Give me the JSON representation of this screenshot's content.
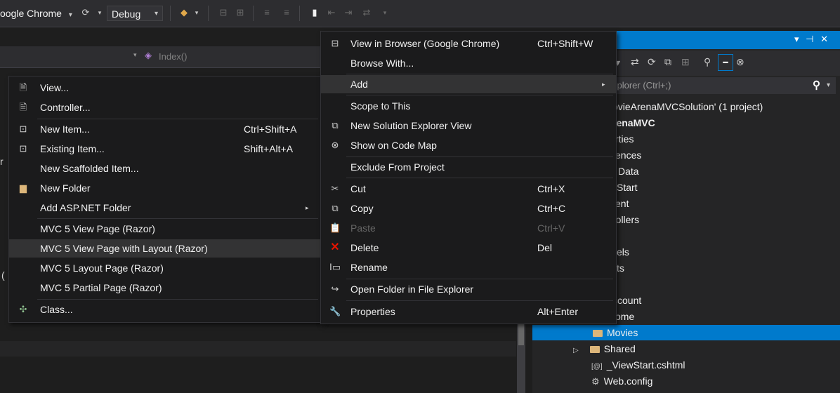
{
  "toolbar": {
    "browser_combo": "oogle Chrome",
    "browser_arrow": "▾",
    "config_combo": "Debug",
    "config_arrow": "▾"
  },
  "navbar": {
    "member": "Index()"
  },
  "solution_explorer": {
    "title_pin": "▾ ⊣ ✕",
    "search_placeholder": "xplorer (Ctrl+;)",
    "search_icon_text": "⚲",
    "tree": [
      "ovieArenaMVCSolution' (1 project)",
      "renaMVC",
      "rties",
      "ences",
      "Data",
      "Start",
      "ent",
      "rollers",
      "els",
      "ts",
      "",
      "ccount",
      "ome",
      "Movies",
      "Shared",
      "_ViewStart.cshtml",
      "Web.config"
    ],
    "shared_arrow": "▷"
  },
  "editor_fragments": {
    "frag1": "r",
    "frag2": "("
  },
  "context_menu": {
    "items": [
      {
        "label": "View in Browser (Google Chrome)",
        "shortcut": "Ctrl+Shift+W"
      },
      {
        "label": "Browse With..."
      },
      {
        "label": "Add",
        "arrow": "▸"
      },
      {
        "label": "Scope to This"
      },
      {
        "label": "New Solution Explorer View"
      },
      {
        "label": "Show on Code Map"
      },
      {
        "label": "Exclude From Project"
      },
      {
        "label": "Cut",
        "shortcut": "Ctrl+X"
      },
      {
        "label": "Copy",
        "shortcut": "Ctrl+C"
      },
      {
        "label": "Paste",
        "shortcut": "Ctrl+V"
      },
      {
        "label": "Delete",
        "shortcut": "Del"
      },
      {
        "label": "Rename"
      },
      {
        "label": "Open Folder in File Explorer"
      },
      {
        "label": "Properties",
        "shortcut": "Alt+Enter"
      }
    ]
  },
  "add_submenu": {
    "items": [
      {
        "label": "View..."
      },
      {
        "label": "Controller..."
      },
      {
        "label": "New Item...",
        "shortcut": "Ctrl+Shift+A"
      },
      {
        "label": "Existing Item...",
        "shortcut": "Shift+Alt+A"
      },
      {
        "label": "New Scaffolded Item..."
      },
      {
        "label": "New Folder"
      },
      {
        "label": "Add ASP.NET Folder",
        "arrow": "▸"
      },
      {
        "label": "MVC 5 View Page (Razor)"
      },
      {
        "label": "MVC 5 View Page with Layout (Razor)"
      },
      {
        "label": "MVC 5 Layout Page (Razor)"
      },
      {
        "label": "MVC 5 Partial Page (Razor)"
      },
      {
        "label": "Class..."
      }
    ]
  },
  "colors": {
    "accent": "#007acc",
    "menu_bg": "#1b1b1c",
    "highlight": "#333334",
    "delete_red": "#e51400",
    "folder": "#dcb67a"
  }
}
